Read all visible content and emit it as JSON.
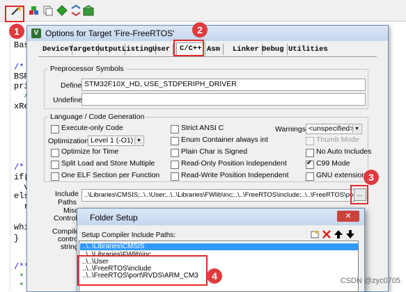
{
  "toolbar": {
    "icons": [
      "options-wand-icon",
      "load-icon",
      "copy-icon",
      "green-diamond-icon",
      "arrows-icon",
      "pack-installer-icon"
    ]
  },
  "editor": {
    "lines": [
      {
        "text": "Bas",
        "style": "plain"
      },
      {
        "text": "/*",
        "style": "blue"
      },
      {
        "text": "BSP",
        "style": "plain"
      },
      {
        "text": "pri",
        "style": "plain"
      },
      {
        "text": "  /*",
        "style": "green"
      },
      {
        "text": "xRe",
        "style": "plain"
      },
      {
        "text": "/*",
        "style": "blue"
      },
      {
        "text": "if(",
        "style": "plain"
      },
      {
        "text": "  v",
        "style": "plain"
      },
      {
        "text": "els",
        "style": "plain"
      },
      {
        "text": "  r",
        "style": "plain"
      },
      {
        "text": "whi",
        "style": "plain"
      },
      {
        "text": "}",
        "style": "plain"
      },
      {
        "text": "/****",
        "style": "blue"
      },
      {
        "text": " * @",
        "style": "green"
      },
      {
        "text": " * @",
        "style": "green"
      }
    ]
  },
  "dialog": {
    "title": "Options for Target 'Fire-FreeRTOS'",
    "tabs": [
      "Device",
      "Target",
      "Output",
      "Listing",
      "User",
      "C/C++",
      "Asm",
      "Linker",
      "Debug",
      "Utilities"
    ],
    "active_tab": "C/C++",
    "preprocessor": {
      "group_title": "Preprocessor Symbols",
      "define_label": "Define:",
      "define_value": "STM32F10X_HD, USE_STDPERIPH_DRIVER",
      "undefine_label": "Undefine:",
      "undefine_value": ""
    },
    "language": {
      "group_title": "Language / Code Generation",
      "checkboxes": [
        {
          "label": "Execute-only Code",
          "checked": false
        },
        {
          "label": "Strict ANSI C",
          "checked": false
        },
        {
          "label": "Enum Container always int",
          "checked": false
        },
        {
          "label": "Optimize for Time",
          "checked": false
        },
        {
          "label": "Plain Char is Signed",
          "checked": false
        },
        {
          "label": "No Auto Includes",
          "checked": false
        },
        {
          "label": "Split Load and Store Multiple",
          "checked": false
        },
        {
          "label": "Read-Only Position Independent",
          "checked": false
        },
        {
          "label": "C99 Mode",
          "checked": true
        },
        {
          "label": "One ELF Section per Function",
          "checked": false
        },
        {
          "label": "Read-Write Position Independent",
          "checked": false
        },
        {
          "label": "GNU extensions",
          "checked": false
        },
        {
          "label": "Thumb Mode",
          "checked": false,
          "disabled": true
        }
      ],
      "optimization_label": "Optimization:",
      "optimization_value": "Level 1 (-O1)",
      "warnings_label": "Warnings:",
      "warnings_value": "<unspecified>"
    },
    "include": {
      "label_line1": "Include",
      "label_line2": "Paths",
      "value": "..\\Libraries\\CMSIS;..\\..\\User;..\\..\\Libraries\\FWlib\\inc;..\\..\\FreeRTOS\\include;..\\..\\FreeRTOS\\port",
      "browse_label": "..."
    },
    "partial_labels": [
      "Misc",
      "Controls",
      "Compiler",
      "control",
      "string"
    ]
  },
  "folder_setup": {
    "title": "Folder Setup",
    "close_label": "✕",
    "list_label": "Setup Compiler Include Paths:",
    "paths": [
      "..\\..\\Libraries\\CMSIS",
      "..\\..\\Libraries\\FWlib\\inc",
      "..\\..\\User",
      "..\\..\\FreeRTOS\\include",
      "..\\..\\FreeRTOS\\port\\RVDS\\ARM_CM3"
    ],
    "selected_index": 0,
    "tool_icons": [
      "new-folder-icon",
      "delete-icon",
      "move-down-icon",
      "move-up-icon"
    ]
  },
  "annotations": {
    "badges": [
      "1",
      "2",
      "3",
      "4"
    ]
  },
  "watermark": "CSDN @zyc0705",
  "colors": {
    "annotation_red": "#e0282a",
    "selection_blue": "#3399ff",
    "dialog_bg": "#f0f0f0"
  }
}
